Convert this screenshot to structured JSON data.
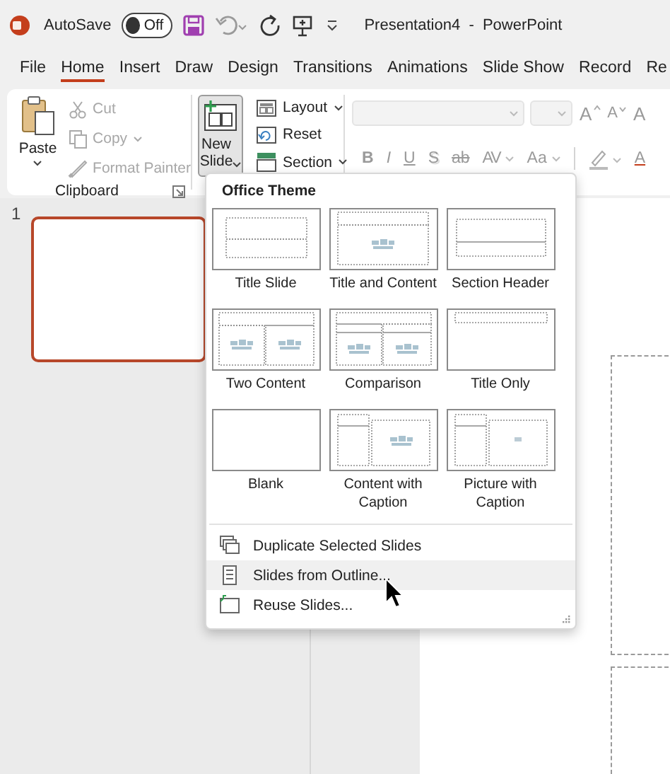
{
  "title_bar": {
    "autosave_label": "AutoSave",
    "autosave_toggle": {
      "label": "Off",
      "on": false
    },
    "title": "Presentation4  -  PowerPoint"
  },
  "tabs": [
    {
      "label": "File",
      "selected": false
    },
    {
      "label": "Home",
      "selected": true
    },
    {
      "label": "Insert",
      "selected": false
    },
    {
      "label": "Draw",
      "selected": false
    },
    {
      "label": "Design",
      "selected": false
    },
    {
      "label": "Transitions",
      "selected": false
    },
    {
      "label": "Animations",
      "selected": false
    },
    {
      "label": "Slide Show",
      "selected": false
    },
    {
      "label": "Record",
      "selected": false
    },
    {
      "label": "Re",
      "selected": false
    }
  ],
  "ribbon": {
    "clipboard": {
      "paste": "Paste",
      "items": [
        {
          "label": "Cut",
          "kind": "cut",
          "disabled": true,
          "dropdown": false
        },
        {
          "label": "Copy",
          "kind": "copy",
          "disabled": true,
          "dropdown": true
        },
        {
          "label": "Format Painter",
          "kind": "painter",
          "disabled": true,
          "dropdown": false
        }
      ],
      "group_label": "Clipboard"
    },
    "slides": {
      "new_slide": {
        "label": "New Slide",
        "pressed": true
      },
      "items": [
        {
          "label": "Layout",
          "kind": "layout",
          "dropdown": true
        },
        {
          "label": "Reset",
          "kind": "reset",
          "dropdown": false
        },
        {
          "label": "Section",
          "kind": "section",
          "dropdown": true
        }
      ]
    },
    "font": {
      "size_buttons": [
        {
          "label": "A",
          "kind": "grow"
        },
        {
          "label": "A",
          "kind": "shrink"
        },
        {
          "label": "A",
          "kind": "clear"
        }
      ],
      "format_buttons": [
        {
          "label": "B",
          "kind": "bold"
        },
        {
          "label": "I",
          "kind": "italic"
        },
        {
          "label": "U",
          "kind": "underline"
        },
        {
          "label": "S",
          "kind": "shadow"
        },
        {
          "label": "ab",
          "kind": "strike"
        },
        {
          "label": "AV",
          "kind": "spacing"
        },
        {
          "label": "Aa",
          "kind": "case"
        }
      ],
      "color_button": "A"
    }
  },
  "slide_panel": {
    "slides": [
      {
        "number": "1",
        "selected": true
      }
    ]
  },
  "new_slide_menu": {
    "heading": "Office Theme",
    "layouts": [
      {
        "name": "Title Slide",
        "kind": "title"
      },
      {
        "name": "Title and Content",
        "kind": "title_content"
      },
      {
        "name": "Section Header",
        "kind": "section"
      },
      {
        "name": "Two Content",
        "kind": "two"
      },
      {
        "name": "Comparison",
        "kind": "comparison"
      },
      {
        "name": "Title Only",
        "kind": "title_only"
      },
      {
        "name": "Blank",
        "kind": "blank"
      },
      {
        "name": "Content with Caption",
        "kind": "content_caption"
      },
      {
        "name": "Picture with Caption",
        "kind": "picture_caption"
      }
    ],
    "commands": [
      {
        "label": "Duplicate Selected Slides",
        "kind": "duplicate",
        "selected": false
      },
      {
        "label": "Slides from Outline...",
        "kind": "outline",
        "selected": true
      },
      {
        "label": "Reuse Slides...",
        "kind": "reuse",
        "selected": false
      }
    ]
  }
}
